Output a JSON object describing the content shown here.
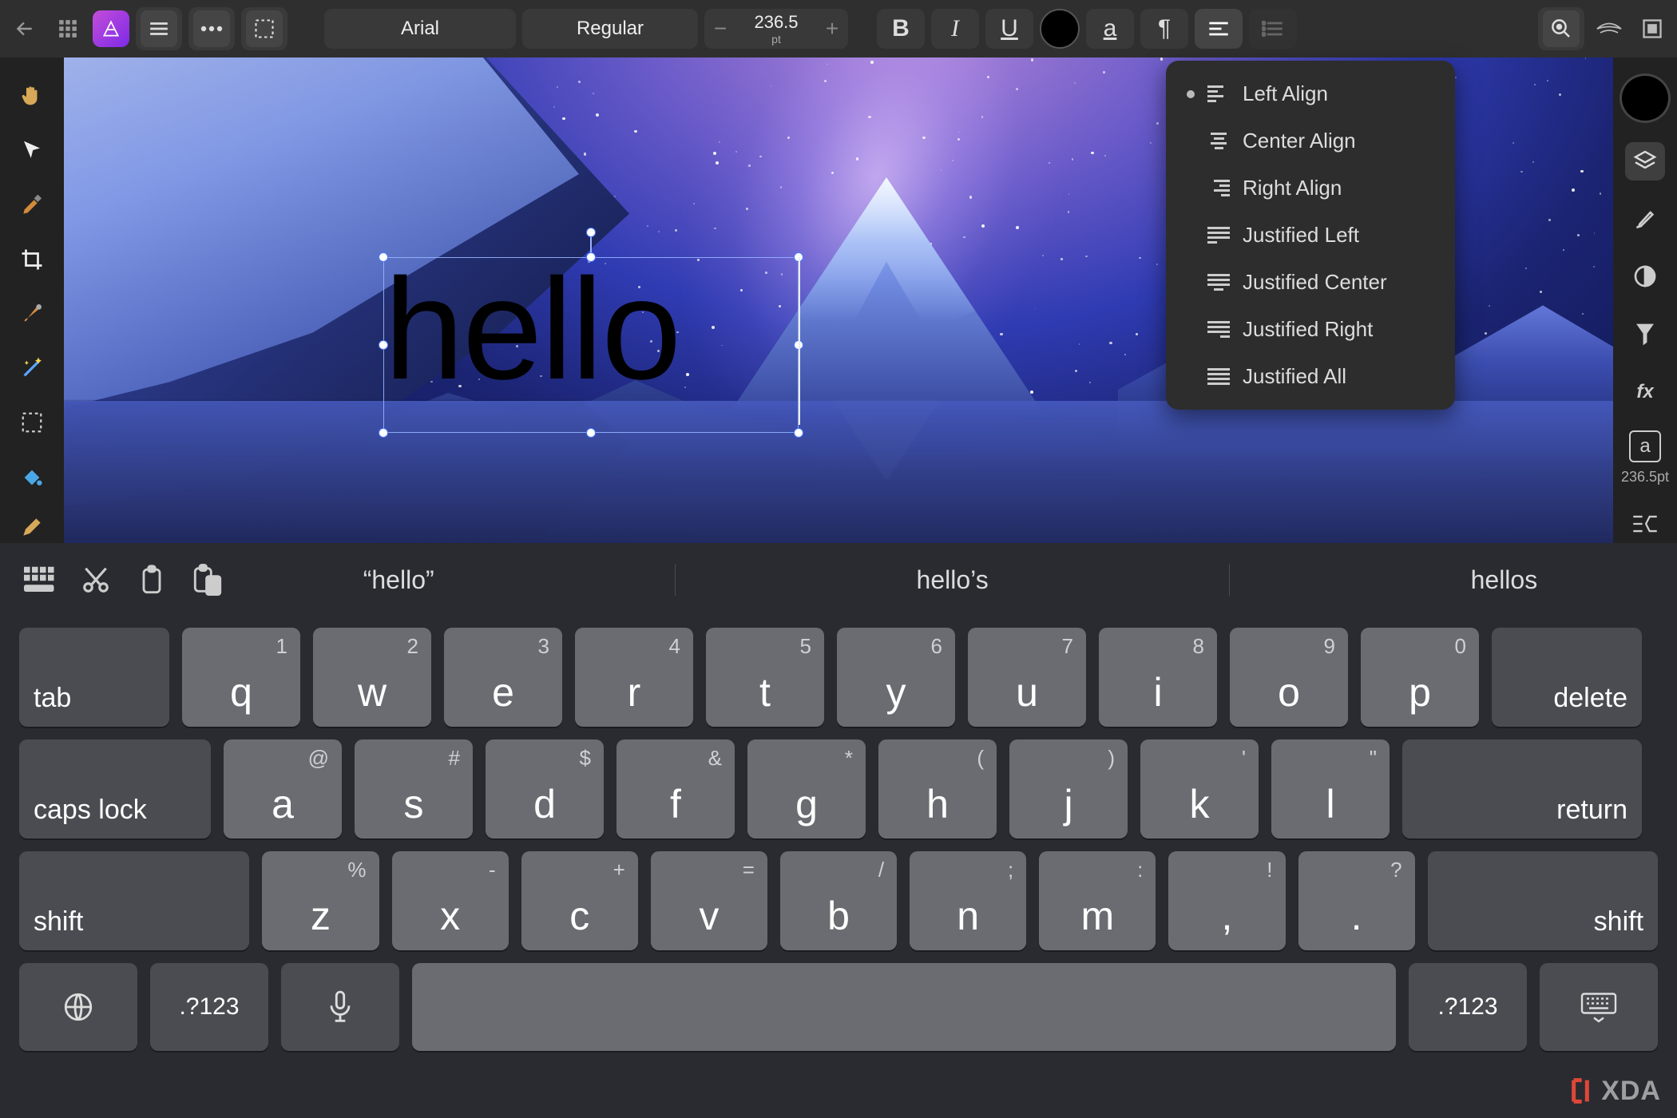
{
  "toolbar": {
    "font_family": "Arial",
    "font_style": "Regular",
    "font_size_value": "236.5",
    "font_size_unit": "pt",
    "minus": "−",
    "plus": "+",
    "bold_label": "B",
    "italic_label": "I",
    "underline_label": "U",
    "charstyle_label": "a"
  },
  "alignment_menu": {
    "selected_index": 0,
    "items": [
      {
        "label": "Left Align",
        "mode": "left"
      },
      {
        "label": "Center Align",
        "mode": "center"
      },
      {
        "label": "Right Align",
        "mode": "right"
      },
      {
        "label": "Justified Left",
        "mode": "justify-left"
      },
      {
        "label": "Justified Center",
        "mode": "justify-center"
      },
      {
        "label": "Justified Right",
        "mode": "justify-right"
      },
      {
        "label": "Justified All",
        "mode": "justify-all"
      }
    ]
  },
  "right_panel": {
    "char_label": "a",
    "char_size_label": "236.5pt"
  },
  "canvas": {
    "text_content": "hello",
    "text_color": "#000000",
    "fill_color": "#000000"
  },
  "keyboard": {
    "suggestions": [
      "“hello”",
      "hello’s",
      "hellos"
    ],
    "row1": [
      {
        "main": "q",
        "sec": "1"
      },
      {
        "main": "w",
        "sec": "2"
      },
      {
        "main": "e",
        "sec": "3"
      },
      {
        "main": "r",
        "sec": "4"
      },
      {
        "main": "t",
        "sec": "5"
      },
      {
        "main": "y",
        "sec": "6"
      },
      {
        "main": "u",
        "sec": "7"
      },
      {
        "main": "i",
        "sec": "8"
      },
      {
        "main": "o",
        "sec": "9"
      },
      {
        "main": "p",
        "sec": "0"
      }
    ],
    "row2": [
      {
        "main": "a",
        "sec": "@"
      },
      {
        "main": "s",
        "sec": "#"
      },
      {
        "main": "d",
        "sec": "$"
      },
      {
        "main": "f",
        "sec": "&"
      },
      {
        "main": "g",
        "sec": "*"
      },
      {
        "main": "h",
        "sec": "("
      },
      {
        "main": "j",
        "sec": ")"
      },
      {
        "main": "k",
        "sec": "'"
      },
      {
        "main": "l",
        "sec": "\""
      }
    ],
    "row3": [
      {
        "main": "z",
        "sec": "%"
      },
      {
        "main": "x",
        "sec": "-"
      },
      {
        "main": "c",
        "sec": "+"
      },
      {
        "main": "v",
        "sec": "="
      },
      {
        "main": "b",
        "sec": "/"
      },
      {
        "main": "n",
        "sec": ";"
      },
      {
        "main": "m",
        "sec": ":"
      },
      {
        "main": ",",
        "sec": "!"
      },
      {
        "main": ".",
        "sec": "?"
      }
    ],
    "tab": "tab",
    "delete": "delete",
    "caps": "caps lock",
    "ret": "return",
    "shift_l": "shift",
    "shift_r": "shift",
    "numsym_l": ".?123",
    "numsym_r": ".?123"
  },
  "watermark": {
    "text": "XDA"
  }
}
